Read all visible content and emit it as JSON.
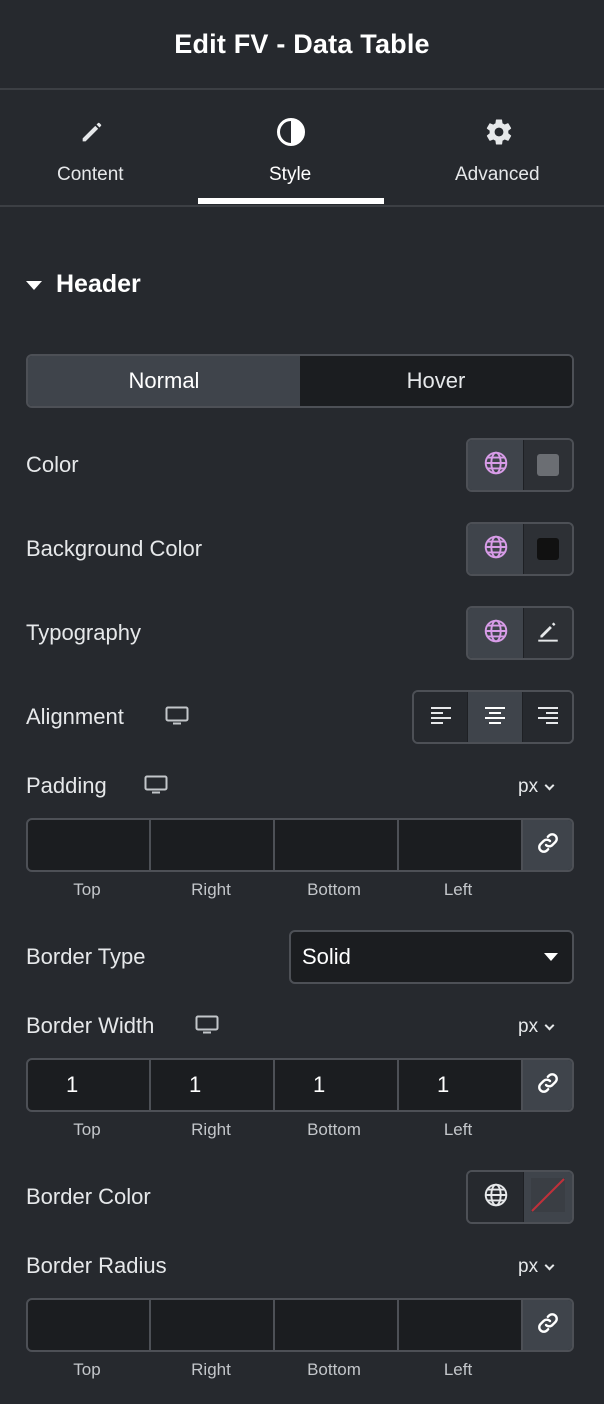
{
  "panel": {
    "title": "Edit FV - Data Table"
  },
  "tabs": [
    {
      "label": "Content",
      "icon": "pencil-icon"
    },
    {
      "label": "Style",
      "icon": "half-circle-icon",
      "active": true
    },
    {
      "label": "Advanced",
      "icon": "gear-icon"
    }
  ],
  "section": {
    "title": "Header",
    "expanded": true
  },
  "state_toggle": {
    "normal": "Normal",
    "hover": "Hover",
    "active": "Normal"
  },
  "color": {
    "label": "Color",
    "swatch": "#6b6e73",
    "global_color": "#d89ce8"
  },
  "background_color": {
    "label": "Background Color",
    "swatch": "#111111"
  },
  "typography": {
    "label": "Typography"
  },
  "alignment": {
    "label": "Alignment",
    "selected": "center"
  },
  "padding": {
    "label": "Padding",
    "unit": "px",
    "values": [
      "",
      "",
      "",
      ""
    ],
    "sides": [
      "Top",
      "Right",
      "Bottom",
      "Left"
    ]
  },
  "border_type": {
    "label": "Border Type",
    "value": "Solid"
  },
  "border_width": {
    "label": "Border Width",
    "unit": "px",
    "values": [
      "1",
      "1",
      "1",
      "1"
    ],
    "sides": [
      "Top",
      "Right",
      "Bottom",
      "Left"
    ]
  },
  "border_color": {
    "label": "Border Color",
    "state": "unset",
    "slash_color": "#c0303a"
  },
  "border_radius": {
    "label": "Border Radius",
    "unit": "px",
    "values": [
      "",
      "",
      "",
      ""
    ],
    "sides": [
      "Top",
      "Right",
      "Bottom",
      "Left"
    ]
  }
}
